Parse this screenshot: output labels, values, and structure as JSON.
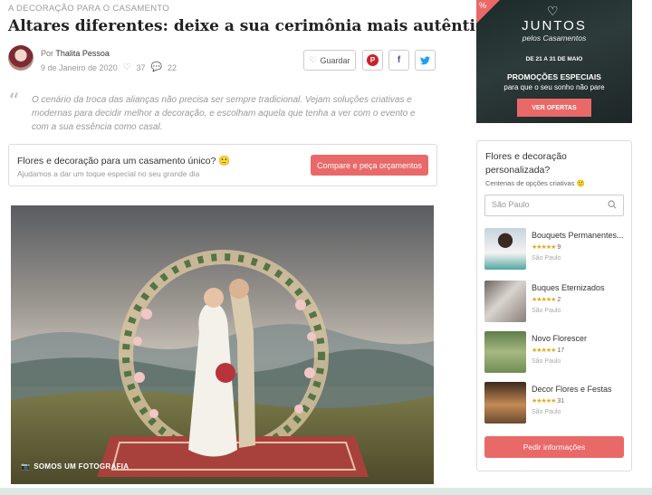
{
  "article": {
    "breadcrumb": "A DECORAÇÃO PARA O CASAMENTO",
    "title": "Altares diferentes: deixe a sua cerimônia mais autêntica",
    "author_prefix": "Por ",
    "author": "Thalita Pessoa",
    "date": "9 de Janeiro de 2020",
    "likes": "37",
    "comments": "22",
    "save_label": "Guardar",
    "intro": "O cenário da troca das alianças não precisa ser sempre tradicional. Vejam soluções criativas e modernas para decidir melhor a decoração, e escolham aquela que tenha a ver com o evento e com a sua essência como casal.",
    "photo_credit": "SOMOS UM FOTOGRAFIA"
  },
  "cta": {
    "title": "Flores e decoração para um casamento único?",
    "subtitle": "Ajudamos a dar um toque especial no seu grande dia",
    "button": "Compare e peça orçamentos"
  },
  "ad": {
    "badge": "%",
    "brand": "JUNTOS",
    "brand_sub": "pelos Casamentos",
    "dates": "DE 21 A 31 DE MAIO",
    "promo": "PROMOÇÕES ESPECIAIS",
    "promo_sub": "para que o seu sonho não pare",
    "button": "VER OFERTAS"
  },
  "sidebar": {
    "title": "Flores e decoração personalizada?",
    "subtitle": "Centenas de opções criativas",
    "search_placeholder": "São Paulo",
    "vendors": [
      {
        "name": "Bouquets Permanentes...",
        "stars": "★★★★★",
        "reviews": "9",
        "city": "São Paulo"
      },
      {
        "name": "Buques Eternizados",
        "stars": "★★★★★",
        "reviews": "2",
        "city": "São Paulo"
      },
      {
        "name": "Novo Florescer",
        "stars": "★★★★★",
        "reviews": "17",
        "city": "São Paulo"
      },
      {
        "name": "Decor Flores e Festas",
        "stars": "★★★★★",
        "reviews": "31",
        "city": "São Paulo"
      }
    ],
    "button": "Pedir informações"
  },
  "icons": {
    "like": "heart-icon",
    "comment": "comment-icon",
    "save": "heart-outline-icon",
    "pinterest": "pinterest-icon",
    "facebook": "facebook-icon",
    "twitter": "twitter-icon",
    "quote": "quote-icon",
    "camera": "camera-icon",
    "search": "search-icon"
  },
  "colors": {
    "accent": "#e96969",
    "star": "#e6a817"
  }
}
